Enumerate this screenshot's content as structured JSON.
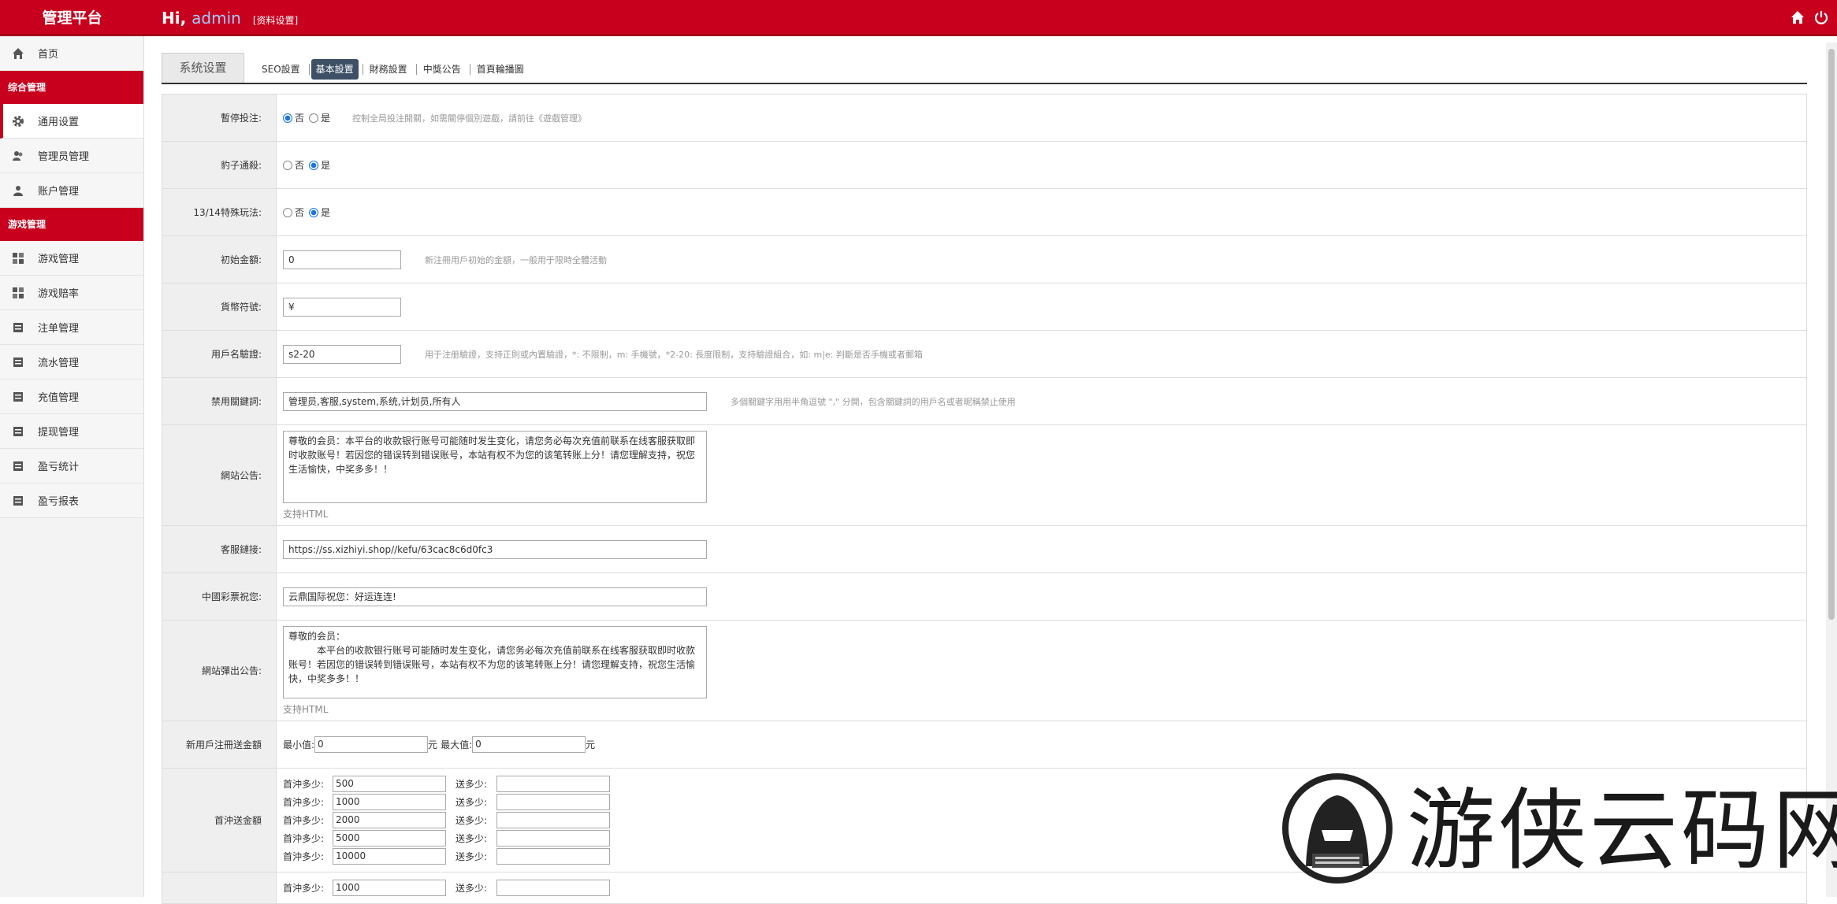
{
  "header": {
    "brand": "管理平台",
    "greeting": "Hi,",
    "user": "admin",
    "profile_link": "[资料设置]",
    "home_icon": "home-icon",
    "power_icon": "power-icon"
  },
  "sidebar": {
    "home": "首页",
    "section1": "综合管理",
    "items1": [
      "通用设置",
      "管理员管理",
      "账户管理"
    ],
    "section2": "游戏管理",
    "items2": [
      "游戏管理",
      "游戏赔率",
      "注单管理",
      "流水管理",
      "充值管理",
      "提现管理",
      "盈亏统计",
      "盈亏报表"
    ]
  },
  "tabs": {
    "main": "系统设置",
    "subtabs": [
      "SEO設置",
      "基本設置",
      "財務設置",
      "中獎公告",
      "首頁輪播圖"
    ],
    "active": "基本設置"
  },
  "form": {
    "pause_label": "暫停投注:",
    "no": "否",
    "yes": "是",
    "pause_hint": "控制全局投注開關，如需關停個別遊戲，請前往《遊戲管理》",
    "leopard_label": "豹子通殺:",
    "special_label": "13/14特殊玩法:",
    "init_label": "初始金額:",
    "init_value": "0",
    "init_hint": "新注冊用戶初始的金額，一般用于限時全體活動",
    "currency_label": "貨幣符號:",
    "currency_value": "¥",
    "uname_label": "用戶名驗證:",
    "uname_value": "s2-20",
    "uname_hint": "用于注册驗證，支持正則或內置驗證，*: 不限制，m: 手機號，*2-20: 長度限制，支持驗證組合，如: m|e: 判斷是否手機或者郵箱",
    "ban_label": "禁用關鍵詞:",
    "ban_value": "管理员,客服,system,系统,计划员,所有人",
    "ban_hint": "多個關鍵字用用半角逗號 \",\" 分開，包含關鍵詞的用戶名或者昵稱禁止使用",
    "notice_label": "網站公告:",
    "notice_value": "尊敬的会员：本平台的收款银行账号可能随时发生变化，请您务必每次充值前联系在线客服获取即时收款账号！若因您的错误转到错误账号，本站有权不为您的该笔转账上分！请您理解支持，祝您生活愉快，中奖多多！！",
    "html_support": "支持HTML",
    "cs_label": "客服鏈接:",
    "cs_value": "https://ss.xizhiyi.shop//kefu/63cac8c6d0fc3",
    "greet_label": "中國彩票祝您:",
    "greet_value": "云鼎国际祝您：好运连连!",
    "popup_label": "網站彈出公告:",
    "popup_line1": "尊敬的会员：",
    "popup_value": "本平台的收款银行账号可能随时发生变化，请您务必每次充值前联系在线客服获取即时收款账号！若因您的错误转到错误账号，本站有权不为您的该笔转账上分！请您理解支持，祝您生活愉快，中奖多多！！",
    "reg_label": "新用戶注冊送金額",
    "min_label": "最小值:",
    "min_value": "0",
    "yuan": "元",
    "max_label": "最大值:",
    "max_value": "0",
    "first_label": "首沖送金額",
    "first_q": "首沖多少:",
    "give_q": "送多少:",
    "first_values": [
      "500",
      "1000",
      "2000",
      "5000",
      "10000"
    ],
    "next_value": "1000"
  },
  "watermark": {
    "text": "游侠云码网"
  }
}
